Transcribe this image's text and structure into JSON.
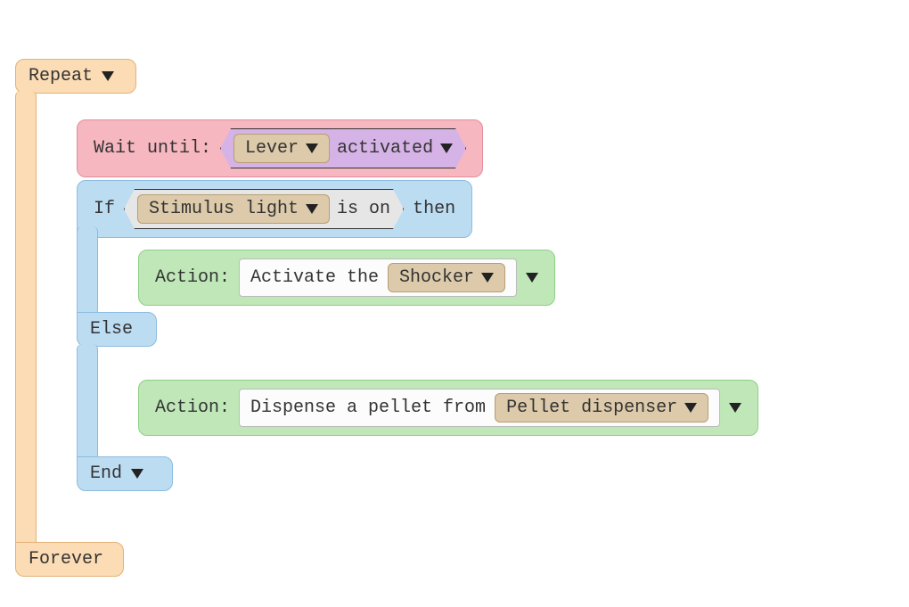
{
  "repeat": {
    "label": "Repeat",
    "end_label": "Forever"
  },
  "wait": {
    "prefix": "Wait until:",
    "object": "Lever",
    "state": "activated"
  },
  "if_block": {
    "keyword": "If",
    "object": "Stimulus light",
    "cond": "is on",
    "then": "then",
    "else": "Else",
    "end": "End"
  },
  "action_then": {
    "prefix": "Action:",
    "phrase": "Activate the",
    "target": "Shocker"
  },
  "action_else": {
    "prefix": "Action:",
    "phrase": "Dispense a pellet from",
    "target": "Pellet dispenser"
  }
}
